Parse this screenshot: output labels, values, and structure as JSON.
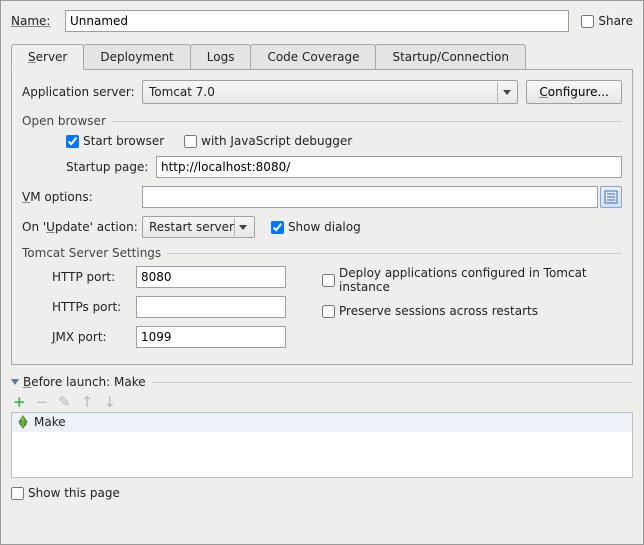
{
  "name_label": "Name:",
  "name_value": "Unnamed",
  "share_label": "Share",
  "share_checked": false,
  "tabs": {
    "server_prefix": "S",
    "server_rest": "erver",
    "deployment": "Deployment",
    "logs": "Logs",
    "code_coverage": "Code Coverage",
    "startup": "Startup/Connection"
  },
  "appserver": {
    "label": "Application server:",
    "selected": "Tomcat 7.0",
    "configure_prefix": "C",
    "configure_rest": "onfigure..."
  },
  "open_browser": {
    "title": "Open browser",
    "start_browser_label": "Start browser",
    "start_browser_checked": true,
    "js_debug_label": "with JavaScript debugger",
    "js_debug_checked": false,
    "startup_page_label": "Startup page:",
    "startup_page_value": "http://localhost:8080/"
  },
  "vm": {
    "label_prefix": "V",
    "label_rest": "M options:",
    "value": ""
  },
  "update": {
    "label_pre": "On '",
    "label_u": "U",
    "label_post": "pdate' action:",
    "selected": "Restart server",
    "show_dialog_label": "Show dialog",
    "show_dialog_checked": true
  },
  "tomcat": {
    "title": "Tomcat Server Settings",
    "http_label": "HTTP port:",
    "http_value": "8080",
    "https_label": "HTTPs port:",
    "https_value": "",
    "jmx_label_prefix": "J",
    "jmx_label_rest": "MX port:",
    "jmx_value": "1099",
    "deploy_label": "Deploy applications configured in Tomcat instance",
    "deploy_checked": false,
    "preserve_label": "Preserve sessions across restarts",
    "preserve_checked": false
  },
  "before_launch": {
    "title_prefix": "B",
    "title_rest": "efore launch: Make",
    "item": "Make"
  },
  "footer": {
    "show_label": "Show this page",
    "show_checked": false
  }
}
